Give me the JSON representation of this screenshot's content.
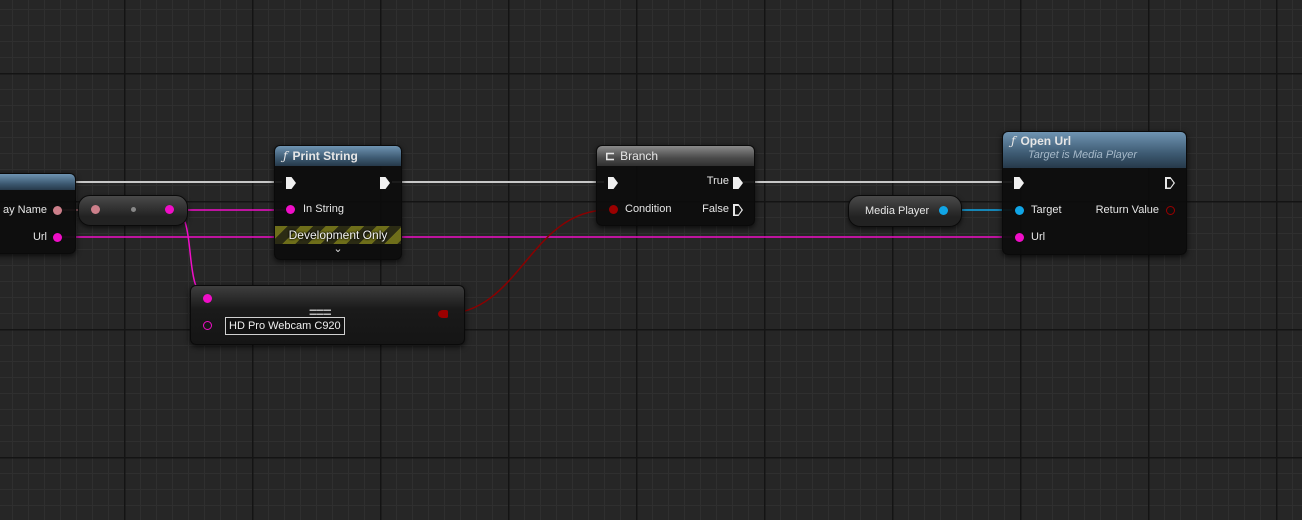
{
  "left_node": {
    "pin_display_name": "ay Name",
    "pin_url": "Url"
  },
  "print_string": {
    "title": "Print String",
    "in_string": "In String",
    "dev_only": "Development Only"
  },
  "branch": {
    "title": "Branch",
    "condition": "Condition",
    "true_label": "True",
    "false_label": "False"
  },
  "equal_node": {
    "symbol": "===",
    "string_value": "HD Pro Webcam C920"
  },
  "media_player_var": {
    "label": "Media Player"
  },
  "open_url": {
    "title": "Open Url",
    "subtitle": "Target is Media Player",
    "target": "Target",
    "return_value": "Return Value",
    "url": "Url"
  },
  "colors": {
    "exec": "#e6e6e6",
    "string_pin": "#ef0ec7",
    "bool_pin": "#9b0000",
    "object_pin": "#10a5e6",
    "name_pin": "#cc7f8a"
  }
}
